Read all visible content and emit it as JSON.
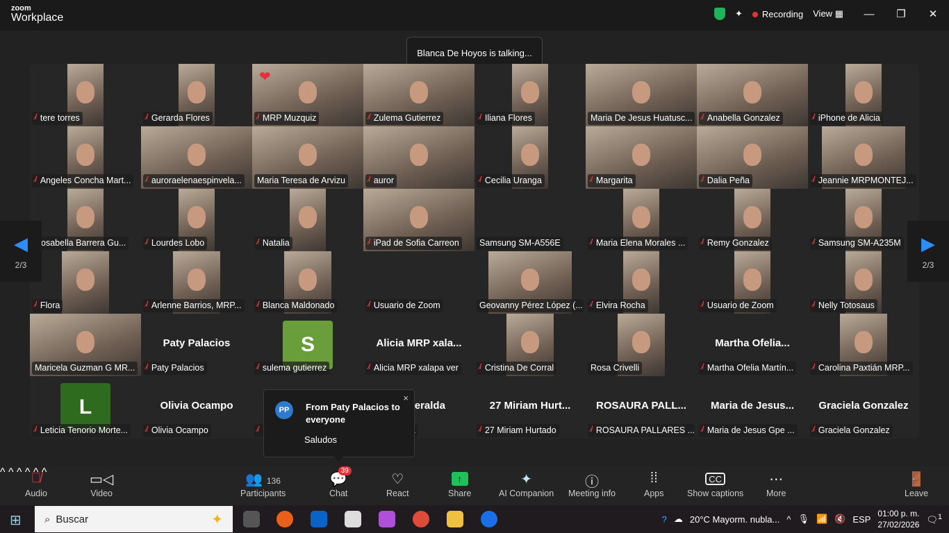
{
  "app": {
    "brand_small": "zoom",
    "brand": "Workplace",
    "recording": "Recording",
    "view": "View",
    "minimize": "—",
    "restore": "❐",
    "close": "✕"
  },
  "talking": "Blanca De Hoyos is talking...",
  "page_indicator": "2/3",
  "tiles": [
    {
      "name": "tere torres",
      "view": "narrow",
      "muted": true
    },
    {
      "name": "Gerarda Flores",
      "view": "narrow",
      "muted": true
    },
    {
      "name": "MRP Muzquiz",
      "view": "wide",
      "muted": true,
      "reaction": "❤"
    },
    {
      "name": "Zulema Gutierrez",
      "view": "wide",
      "muted": true
    },
    {
      "name": "Iliana Flores",
      "view": "narrow",
      "muted": true
    },
    {
      "name": "Maria De Jesus Huatusc...",
      "view": "wide",
      "muted": false
    },
    {
      "name": "Anabella Gonzalez",
      "view": "wide",
      "muted": true
    },
    {
      "name": "iPhone de Alicia",
      "view": "narrow",
      "muted": true
    },
    {
      "name": "Angeles Concha Mart...",
      "view": "narrow",
      "muted": true
    },
    {
      "name": "auroraelenaespinvela...",
      "view": "wide",
      "muted": true
    },
    {
      "name": "Maria Teresa de Arvizu",
      "view": "wide",
      "muted": false
    },
    {
      "name": "auror",
      "view": "wide",
      "muted": true
    },
    {
      "name": "Cecilia Uranga",
      "view": "narrow",
      "muted": true
    },
    {
      "name": "Margarita",
      "view": "wide",
      "muted": true
    },
    {
      "name": "Dalia Peña",
      "view": "wide",
      "muted": true
    },
    {
      "name": "Jeannie MRPMONTEJ...",
      "view": "w120",
      "muted": true
    },
    {
      "name": "Rosabella Barrera Gu...",
      "view": "narrow",
      "muted": false
    },
    {
      "name": "Lourdes Lobo",
      "view": "narrow",
      "muted": true
    },
    {
      "name": "Natalia",
      "view": "narrow",
      "muted": true
    },
    {
      "name": "iPad de Sofia Carreon",
      "view": "wide",
      "muted": true
    },
    {
      "name": "Samsung SM-A556E",
      "view": "none",
      "muted": false
    },
    {
      "name": "Maria Elena Morales ...",
      "view": "narrow",
      "muted": true
    },
    {
      "name": "Remy Gonzalez",
      "view": "narrow",
      "muted": true
    },
    {
      "name": "Samsung SM-A235M",
      "view": "narrow",
      "muted": true
    },
    {
      "name": "Flora",
      "view": "mid",
      "muted": true
    },
    {
      "name": "Arlenne Barrios, MRP...",
      "view": "mid",
      "muted": true
    },
    {
      "name": "Blanca Maldonado",
      "view": "mid",
      "muted": true
    },
    {
      "name": "Usuario de Zoom",
      "view": "none",
      "muted": true
    },
    {
      "name": "Geovanny Pérez López (...",
      "view": "w120",
      "muted": false
    },
    {
      "name": "Elvira Rocha",
      "view": "narrow",
      "muted": true
    },
    {
      "name": "Usuario de Zoom",
      "view": "narrow",
      "muted": true
    },
    {
      "name": "Nelly Totosaus",
      "view": "narrow",
      "muted": true
    },
    {
      "name": "Maricela Guzman G MR...",
      "view": "wide",
      "muted": false
    },
    {
      "name": "Paty Palacios",
      "view": "text",
      "big": "Paty Palacios",
      "muted": true
    },
    {
      "name": "sulema gutierrez",
      "view": "avatar",
      "letter": "S",
      "color": "#6a9e3a",
      "muted": true
    },
    {
      "name": "Alicia MRP xalapa ver",
      "view": "text",
      "big": "Alicia MRP  xala...",
      "muted": true
    },
    {
      "name": "Cristina De Corral",
      "view": "mid",
      "muted": true
    },
    {
      "name": "Rosa Crivelli",
      "view": "mid",
      "muted": false
    },
    {
      "name": "Martha Ofelia Martín...",
      "view": "text",
      "big": "Martha  Ofelia...",
      "muted": true
    },
    {
      "name": "Carolina Paxtián MRP...",
      "view": "mid",
      "muted": true
    },
    {
      "name": "Leticia Tenorio Morte...",
      "view": "avatar",
      "letter": "L",
      "color": "#2e6b1e",
      "muted": true
    },
    {
      "name": "Olivia Ocampo",
      "view": "text",
      "big": "Olivia Ocampo",
      "muted": true
    },
    {
      "name": "",
      "view": "none",
      "muted": true
    },
    {
      "name": "Esmeralda",
      "view": "text",
      "big": "Esmeralda",
      "muted": true
    },
    {
      "name": "27 Miriam Hurtado",
      "view": "text",
      "big": "27 Miriam Hurt...",
      "muted": true
    },
    {
      "name": "ROSAURA PALLARES ...",
      "view": "text",
      "big": "ROSAURA PALL...",
      "muted": true
    },
    {
      "name": "Maria de Jesus Gpe ...",
      "view": "text",
      "big": "Maria de Jesus...",
      "muted": true
    },
    {
      "name": "Graciela Gonzalez",
      "view": "text",
      "big": "Graciela Gonzalez",
      "muted": true
    }
  ],
  "chat_popup": {
    "initials": "PP",
    "from": "From Paty Palacios to everyone",
    "message": "Saludos",
    "close": "×"
  },
  "toolbar": {
    "audio": "Audio",
    "video": "Video",
    "participants": "Participants",
    "participants_count": "136",
    "chat": "Chat",
    "chat_badge": "39",
    "react": "React",
    "share": "Share",
    "ai": "AI Companion",
    "info": "Meeting info",
    "apps": "Apps",
    "captions": "Show captions",
    "more": "More",
    "leave": "Leave"
  },
  "taskbar": {
    "search": "Buscar",
    "weather": "20°C  Mayorm. nubla...",
    "lang": "ESP",
    "time": "01:00 p. m.",
    "date": "27/02/2026",
    "notif": "1"
  }
}
